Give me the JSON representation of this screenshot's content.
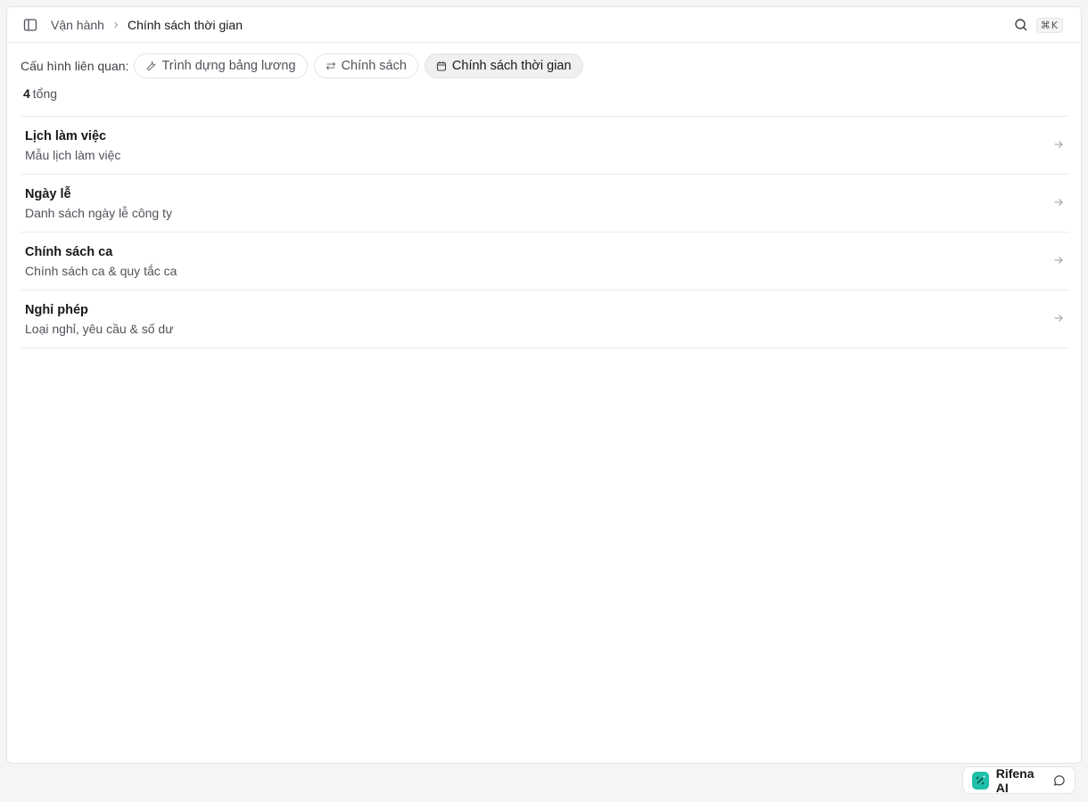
{
  "breadcrumb": {
    "parent": "Vận hành",
    "current": "Chính sách thời gian"
  },
  "search": {
    "shortcut": "⌘K"
  },
  "related": {
    "label": "Cấu hình liên quan:",
    "chips": [
      {
        "label": "Trình dựng bảng lương",
        "icon": "wrench-icon",
        "active": false
      },
      {
        "label": "Chính sách",
        "icon": "sliders-icon",
        "active": false
      },
      {
        "label": "Chính sách thời gian",
        "icon": "calendar-icon",
        "active": true
      }
    ]
  },
  "summary": {
    "count": "4",
    "count_label": "tổng"
  },
  "items": [
    {
      "title": "Lịch làm việc",
      "description": "Mẫu lịch làm việc"
    },
    {
      "title": "Ngày lễ",
      "description": "Danh sách ngày lễ công ty"
    },
    {
      "title": "Chính sách ca",
      "description": "Chính sách ca & quy tắc ca"
    },
    {
      "title": "Nghỉ phép",
      "description": "Loại nghỉ, yêu cầu & số dư"
    }
  ],
  "assistant": {
    "label": "Rifena AI",
    "icon": "sparkle-icon"
  },
  "colors": {
    "accent": "#1fbfa9",
    "border": "#e4e4e7",
    "text": "#18181b",
    "muted": "#52525b"
  }
}
